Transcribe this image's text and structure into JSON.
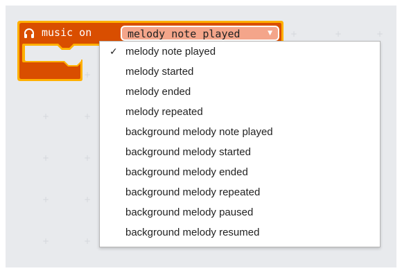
{
  "block": {
    "label": "music on",
    "icon": "headphone-icon",
    "selected": "melody note played",
    "color": "#d94e00"
  },
  "menu": {
    "items": [
      {
        "label": "melody note played",
        "checked": true
      },
      {
        "label": "melody started"
      },
      {
        "label": "melody ended"
      },
      {
        "label": "melody repeated"
      },
      {
        "label": "background melody note played"
      },
      {
        "label": "background melody started"
      },
      {
        "label": "background melody ended"
      },
      {
        "label": "background melody repeated"
      },
      {
        "label": "background melody paused"
      },
      {
        "label": "background melody resumed"
      }
    ],
    "check_glyph": "✓"
  }
}
